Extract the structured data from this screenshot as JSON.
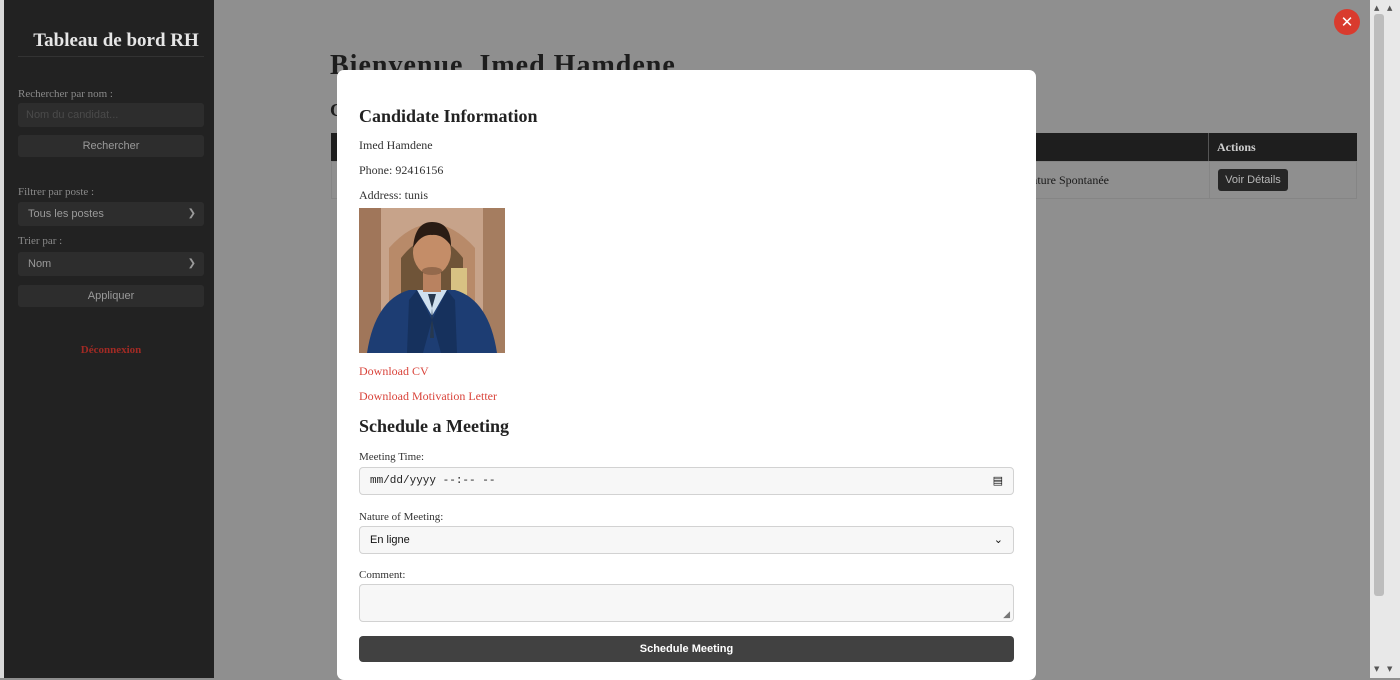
{
  "sidebar": {
    "title": "Tableau de bord RH",
    "search_label": "Rechercher par nom :",
    "search_placeholder": "Nom du candidat...",
    "search_button": "Rechercher",
    "filter_label": "Filtrer par poste :",
    "filter_value": "Tous les postes",
    "sort_label": "Trier par :",
    "sort_value": "Nom",
    "apply_button": "Appliquer",
    "logout": "Déconnexion"
  },
  "main": {
    "welcome": "Bienvenue, Imed Hamdene",
    "subheading": "C",
    "table": {
      "actions_header": "Actions",
      "rows": [
        {
          "nature": "ature Spontanée",
          "action": "Voir Détails"
        }
      ]
    }
  },
  "modal": {
    "close_symbol": "✕",
    "candidate_heading": "Candidate Information",
    "name": "Imed Hamdene",
    "phone": "Phone: 92416156",
    "address": "Address: tunis",
    "download_cv": "Download CV",
    "download_letter": "Download Motivation Letter",
    "schedule_heading": "Schedule a Meeting",
    "meeting_time_label": "Meeting Time:",
    "meeting_time_value": "mm/dd/yyyy --:-- --",
    "nature_label": "Nature of Meeting:",
    "nature_value": "En ligne",
    "comment_label": "Comment:",
    "comment_value": "",
    "submit_button": "Schedule Meeting"
  },
  "colors": {
    "sidebar_bg": "#222222",
    "overlay": "#8f8f8f",
    "accent_red": "#d9443b",
    "submit_bg": "#414141"
  }
}
